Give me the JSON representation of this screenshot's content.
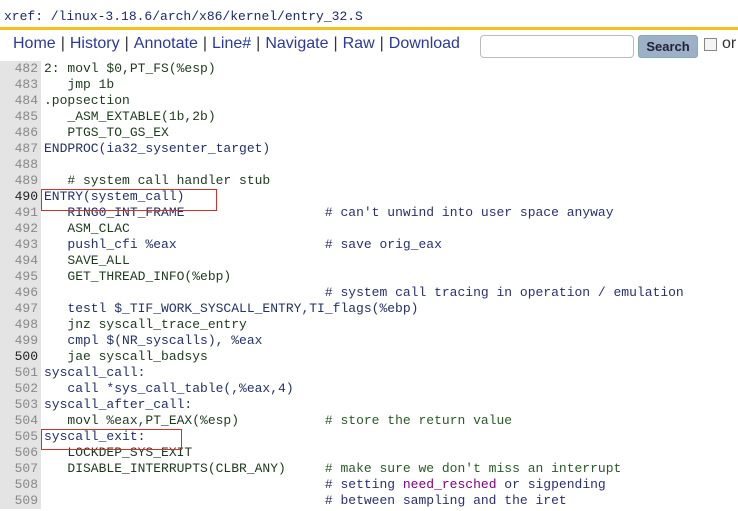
{
  "header": {
    "xref": "xref: /linux-3.18.6/arch/x86/kernel/entry_32.S"
  },
  "nav": {
    "items": [
      "Home",
      "History",
      "Annotate",
      "Line#",
      "Navigate",
      "Raw",
      "Download"
    ],
    "search_placeholder": "",
    "search_button": "Search",
    "option_label": "or"
  },
  "colors": {
    "accent_bar": "#f4c01e",
    "box": "#d03030",
    "highlight": "#800080"
  },
  "lines": [
    {
      "n": "482",
      "code": "2: movl $0,PT_FS(%esp)",
      "comment": ""
    },
    {
      "n": "483",
      "code": "   jmp 1b",
      "comment": ""
    },
    {
      "n": "484",
      "code": ".popsection",
      "comment": ""
    },
    {
      "n": "485",
      "code": "   _ASM_EXTABLE(1b,2b)",
      "comment": ""
    },
    {
      "n": "486",
      "code": "   PTGS_TO_GS_EX",
      "comment": ""
    },
    {
      "n": "487",
      "code": "ENDPROC(ia32_sysenter_target)",
      "comment": ""
    },
    {
      "n": "488",
      "code": "",
      "comment": ""
    },
    {
      "n": "489",
      "code": "   # system call handler stub",
      "comment": ""
    },
    {
      "n": "490",
      "code": "ENTRY(system_call)",
      "comment": ""
    },
    {
      "n": "491",
      "code": "   RING0_INT_FRAME",
      "comment": "# can't unwind into user space anyway"
    },
    {
      "n": "492",
      "code": "   ASM_CLAC",
      "comment": ""
    },
    {
      "n": "493",
      "code": "   pushl_cfi %eax",
      "comment": "# save orig_eax"
    },
    {
      "n": "494",
      "code": "   SAVE_ALL",
      "comment": ""
    },
    {
      "n": "495",
      "code": "   GET_THREAD_INFO(%ebp)",
      "comment": ""
    },
    {
      "n": "496",
      "code": "",
      "comment": "# system call tracing in operation / emulation"
    },
    {
      "n": "497",
      "code": "   testl $_TIF_WORK_SYSCALL_ENTRY,TI_flags(%ebp)",
      "comment": ""
    },
    {
      "n": "498",
      "code": "   jnz syscall_trace_entry",
      "comment": ""
    },
    {
      "n": "499",
      "code": "   cmpl $(NR_syscalls), %eax",
      "comment": ""
    },
    {
      "n": "500",
      "code": "   jae syscall_badsys",
      "comment": ""
    },
    {
      "n": "501",
      "code": "syscall_call:",
      "comment": ""
    },
    {
      "n": "502",
      "code": "   call *sys_call_table(,%eax,4)",
      "comment": ""
    },
    {
      "n": "503",
      "code": "syscall_after_call:",
      "comment": ""
    },
    {
      "n": "504",
      "code": "   movl %eax,PT_EAX(%esp)",
      "comment": "# store the return value"
    },
    {
      "n": "505",
      "code": "syscall_exit:",
      "comment": ""
    },
    {
      "n": "506",
      "code": "   LOCKDEP_SYS_EXIT",
      "comment": ""
    },
    {
      "n": "507",
      "code": "   DISABLE_INTERRUPTS(CLBR_ANY)",
      "comment": "# make sure we don't miss an interrupt"
    },
    {
      "n": "508",
      "code": "",
      "comment": "# setting ",
      "hl": "need_resched",
      "after": " or sigpending"
    },
    {
      "n": "509",
      "code": "",
      "comment": "# between sampling and the iret"
    }
  ]
}
